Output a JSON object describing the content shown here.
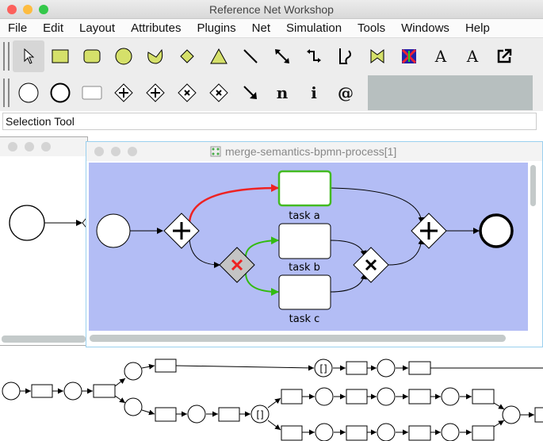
{
  "app": {
    "title": "Reference Net Workshop"
  },
  "menu": [
    "File",
    "Edit",
    "Layout",
    "Attributes",
    "Plugins",
    "Net",
    "Simulation",
    "Tools",
    "Windows",
    "Help"
  ],
  "toolbar": {
    "row1": [
      "selection-tool",
      "rectangle-tool",
      "rounded-rectangle-tool",
      "ellipse-tool",
      "polygon-tool",
      "diamond-tool",
      "triangle-tool",
      "line-tool",
      "connection-tool",
      "elbow-connection-tool",
      "scribble-tool",
      "image-tool",
      "color-image-tool",
      "text-tool",
      "connected-text-tool",
      "link-tool"
    ],
    "row2": [
      "start-event-tool",
      "end-event-tool",
      "task-tool",
      "parallel-gateway-tool",
      "parallel-gateway-alt-tool",
      "exclusive-gateway-tool",
      "exclusive-gateway-alt-tool",
      "arc-tool",
      "n-tool",
      "i-tool",
      "at-tool"
    ],
    "glyphs": {
      "text": "A",
      "connected_text": "A",
      "n": "n",
      "i": "i",
      "at": "@"
    }
  },
  "status": {
    "text": "Selection Tool"
  },
  "drawing_window": {
    "title": "merge-semantics-bpmn-process[1]",
    "tasks": [
      {
        "label": "task a"
      },
      {
        "label": "task b"
      },
      {
        "label": "task c"
      }
    ]
  },
  "colors": {
    "canvas": "#b3bdf5",
    "active_arc": "#ee2222",
    "enabled_arc": "#33bb11",
    "highlight": "#44bb22"
  },
  "petri_net": {
    "guard_label": "[]"
  }
}
